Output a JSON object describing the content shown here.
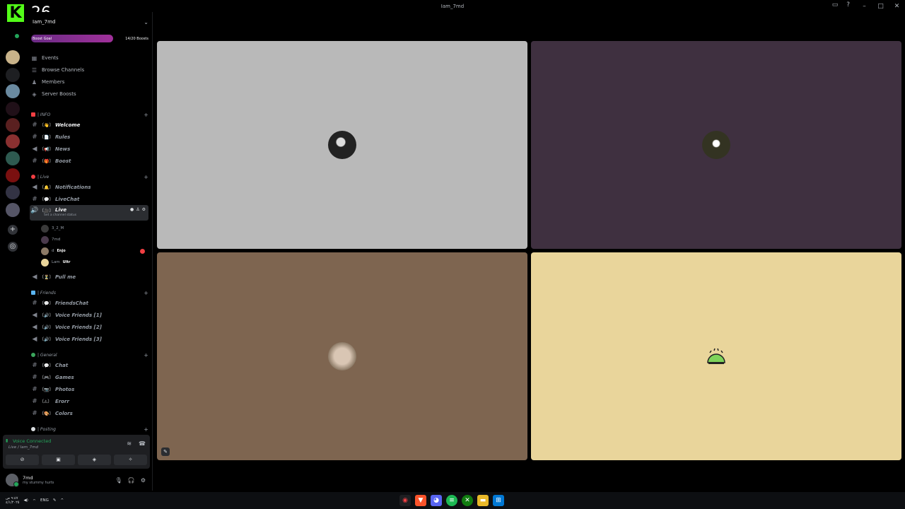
{
  "window": {
    "title": "Iam_7md"
  },
  "overlay": {
    "logo_letter": "K",
    "number": "26"
  },
  "server": {
    "name": "Iam_7md"
  },
  "boost": {
    "label": "Boost Goal",
    "count": "14/20 Boosts",
    "progress_fraction": 0.7
  },
  "nav": [
    {
      "label": "Events",
      "icon": "calendar-icon"
    },
    {
      "label": "Browse Channels",
      "icon": "browse-icon"
    },
    {
      "label": "Members",
      "icon": "members-icon"
    },
    {
      "label": "Server Boosts",
      "icon": "boost-icon"
    }
  ],
  "categories": {
    "info": "| INFO",
    "live": "| Live",
    "friends": "| Friends",
    "general": "| General",
    "posting": "| Posting"
  },
  "channels": {
    "welcome": "Welcome",
    "rules": "Rules",
    "news": "News",
    "boost": "Boost",
    "notifications": "Notifications",
    "livechat": "LiveChat",
    "live": "Live",
    "live_status": "Set a channel status",
    "pullme": "Pull me",
    "friendschat": "FriendsChat",
    "vf1": "Voice Friends [1]",
    "vf2": "Voice Friends [2]",
    "vf3": "Voice Friends [3]",
    "chat": "Chat",
    "games": "Games",
    "photos": "Photos",
    "errors": "Erorr",
    "colors": "Colors"
  },
  "voice_users": [
    {
      "name": "3_2_M",
      "tag": ""
    },
    {
      "name": "7md",
      "tag": ""
    },
    {
      "name": "d",
      "tag": "Enjo"
    },
    {
      "name": "Lam",
      "tag": "Ultr"
    }
  ],
  "voice": {
    "status": "Voice Connected",
    "channel": "Live / Iam_7md"
  },
  "user": {
    "name": "7md",
    "status": "my stummy hurts"
  },
  "taskbar": {
    "lang": "ENG",
    "time": "٩:٤٧ ص",
    "date": "٤/١/٢٠٢٥"
  },
  "colors": {
    "accent": "#53fc18",
    "voice_green": "#23a55a",
    "danger": "#f23f43"
  }
}
